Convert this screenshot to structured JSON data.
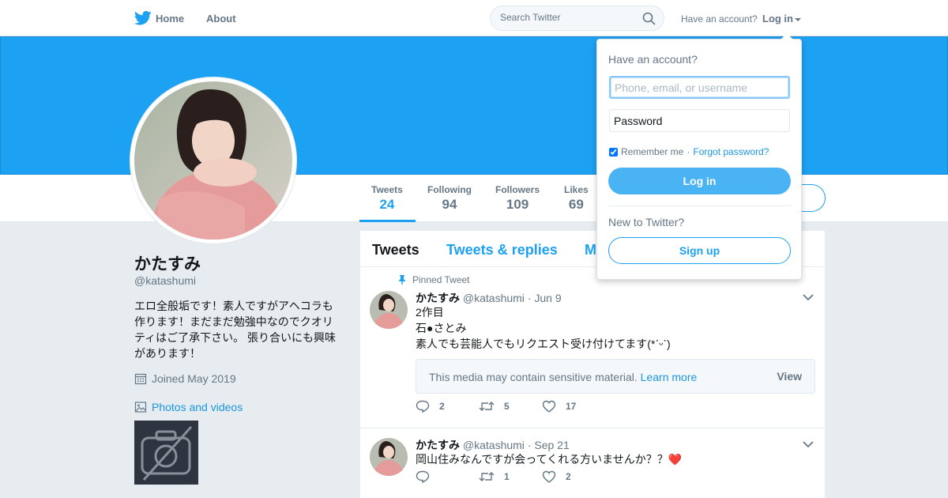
{
  "nav": {
    "home_label": "Home",
    "about_label": "About",
    "search_placeholder": "Search Twitter",
    "have_account": "Have an account?",
    "login_label": "Log in"
  },
  "profile": {
    "name": "かたすみ",
    "handle": "@katashumi",
    "bio": "エロ全般垢です！素人ですがアヘコラも作ります！まだまだ勉強中なのでクオリティはご了承下さい。 張り合いにも興味があります！",
    "joined": "Joined May 2019",
    "photos_label": "Photos and videos"
  },
  "stats": [
    {
      "label": "Tweets",
      "value": "24"
    },
    {
      "label": "Following",
      "value": "94"
    },
    {
      "label": "Followers",
      "value": "109"
    },
    {
      "label": "Likes",
      "value": "69"
    }
  ],
  "timeline": {
    "tabs": [
      "Tweets",
      "Tweets & replies",
      "M"
    ]
  },
  "tweets": [
    {
      "pinned_label": "Pinned Tweet",
      "name": "かたすみ",
      "handle": "@katashumi",
      "date": "· Jun 9",
      "text": "2作目\n石●さとみ\n素人でも芸能人でもリクエスト受け付けてます(*ˊᵕˋ)",
      "sensitive_text": "This media may contain sensitive material.",
      "learn_more": "Learn more",
      "view_label": "View",
      "replies": "2",
      "retweets": "5",
      "likes": "17"
    },
    {
      "name": "かたすみ",
      "handle": "@katashumi",
      "date": "· Sep 21",
      "text": "岡山住みなんですが会ってくれる方いませんか？？",
      "emoji": "❤️",
      "replies": "",
      "retweets": "1",
      "likes": "2"
    }
  ],
  "login_dropdown": {
    "title": "Have an account?",
    "username_placeholder": "Phone, email, or username",
    "password_placeholder": "Password",
    "remember_label": "Remember me",
    "separator": "·",
    "forgot_label": "Forgot password?",
    "login_button": "Log in",
    "new_label": "New to Twitter?",
    "signup_button": "Sign up"
  },
  "colors": {
    "brand": "#1da1f2",
    "banner": "#1da1f2",
    "text_muted": "#657786",
    "background": "#e6ecf0"
  }
}
